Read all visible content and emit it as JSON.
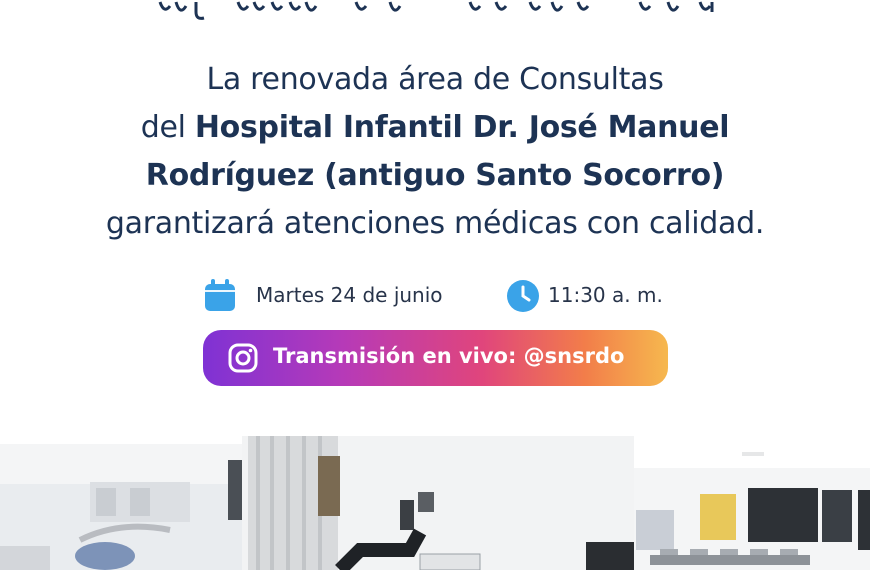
{
  "headline": {
    "line1": "La renovada área de Consultas",
    "line2_prefix": "del ",
    "line2_bold": "Hospital Infantil Dr. José Manuel",
    "line3_bold": "Rodríguez (antiguo Santo Socorro)",
    "line4": "garantizará atenciones médicas con calidad."
  },
  "event": {
    "date": "Martes 24 de junio",
    "time": "11:30 a. m.",
    "date_icon": "calendar-icon",
    "time_icon": "clock-icon"
  },
  "live": {
    "label": "Transmisión en vivo: @snsrdo",
    "icon": "instagram-icon"
  },
  "colors": {
    "text": "#1d3354",
    "icon_blue": "#3aa3e8",
    "gradient_start": "#7f32d4",
    "gradient_end": "#f6b84e"
  }
}
